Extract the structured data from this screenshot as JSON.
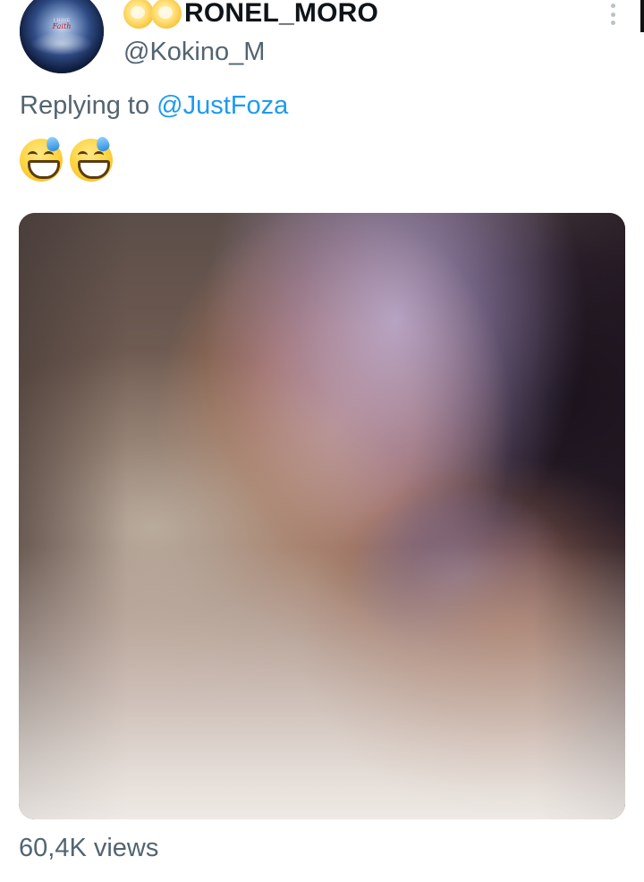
{
  "author": {
    "display_name": "RONEL_MORO",
    "handle": "@Kokino_M",
    "avatar_text": "Faith",
    "avatar_small_text": "I HAVE",
    "name_decoration_icons": [
      "sparkle-emoji-icon",
      "sparkle-emoji-icon"
    ]
  },
  "reply_context": {
    "prefix": "Replying to",
    "mention": "@JustFoza"
  },
  "tweet": {
    "emojis": [
      "grinning-face-with-sweat-icon",
      "grinning-face-with-sweat-icon"
    ]
  },
  "media": {
    "kind": "video-thumbnail"
  },
  "stats": {
    "views_label": "60,4K views"
  },
  "colors": {
    "link": "#1d9bf0",
    "secondary_text": "#536471",
    "primary_text": "#0f1419"
  }
}
